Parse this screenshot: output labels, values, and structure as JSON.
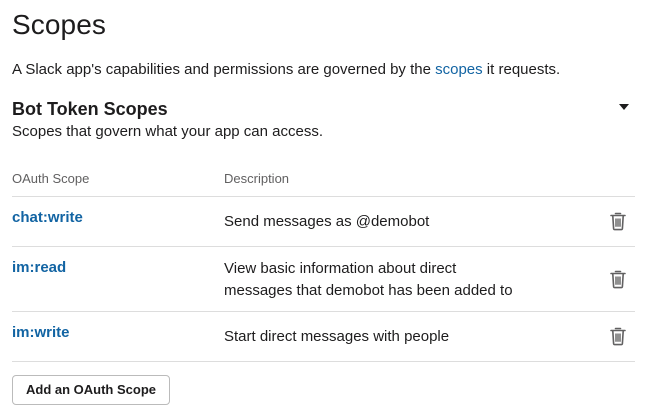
{
  "page": {
    "title": "Scopes",
    "intro_before": "A Slack app's capabilities and permissions are governed by the ",
    "intro_link": "scopes",
    "intro_after": " it requests."
  },
  "section": {
    "title": "Bot Token Scopes",
    "subtitle": "Scopes that govern what your app can access.",
    "collapse_icon": "caret-down-icon"
  },
  "table": {
    "headers": {
      "scope": "OAuth Scope",
      "description": "Description"
    },
    "rows": [
      {
        "scope": "chat:write",
        "description": "Send messages as @demobot",
        "action_icon": "trash-icon"
      },
      {
        "scope": "im:read",
        "description_line1": "View basic information about direct",
        "description_line2": "messages that demobot has been added to",
        "action_icon": "trash-icon"
      },
      {
        "scope": "im:write",
        "description": "Start direct messages with people",
        "action_icon": "trash-icon"
      }
    ]
  },
  "add_button_label": "Add an OAuth Scope",
  "colors": {
    "link": "#1264a3",
    "text": "#1d1c1d",
    "muted": "#616061",
    "divider": "#dddddd"
  }
}
